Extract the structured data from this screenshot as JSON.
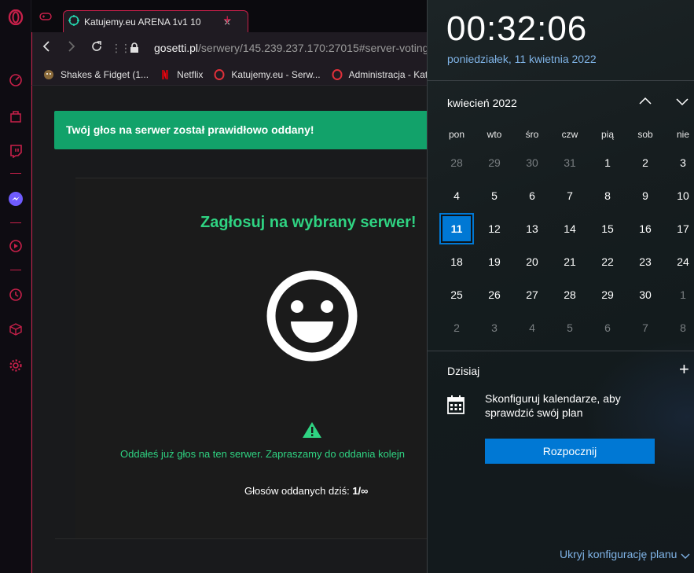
{
  "browser": {
    "tab_title": "Katujemy.eu ARENA 1v1 10",
    "tab_close": "×",
    "new_tab": "+",
    "url_host": "gosetti.pl",
    "url_path": "/serwery/145.239.237.170:27015#server-voting-",
    "bookmarks": [
      {
        "label": "Shakes & Fidget (1...",
        "icon": "shakes-fidget-icon"
      },
      {
        "label": "Netflix",
        "icon": "netflix-icon"
      },
      {
        "label": "Katujemy.eu - Serw...",
        "icon": "opera-small-icon"
      },
      {
        "label": "Administracja - Kat",
        "icon": "opera-small-icon"
      }
    ]
  },
  "page": {
    "alert_text": "Twój głos na serwer został prawidłowo oddany!",
    "vote_title": "Zagłosuj na wybrany serwer!",
    "already_voted": "Oddałeś już głos na ten serwer. Zapraszamy do oddania kolejn",
    "votes_today_label": "Głosów oddanych dziś:",
    "votes_today_value": "1/∞"
  },
  "flyout": {
    "time": "00:32:06",
    "date_long": "poniedziałek, 11 kwietnia 2022",
    "month_label": "kwiecień 2022",
    "weekdays": [
      "pon",
      "wto",
      "śro",
      "czw",
      "pią",
      "sob",
      "nie"
    ],
    "weeks": [
      [
        "28",
        "29",
        "30",
        "31",
        "1",
        "2",
        "3"
      ],
      [
        "4",
        "5",
        "6",
        "7",
        "8",
        "9",
        "10"
      ],
      [
        "11",
        "12",
        "13",
        "14",
        "15",
        "16",
        "17"
      ],
      [
        "18",
        "19",
        "20",
        "21",
        "22",
        "23",
        "24"
      ],
      [
        "25",
        "26",
        "27",
        "28",
        "29",
        "30",
        "1"
      ],
      [
        "2",
        "3",
        "4",
        "5",
        "6",
        "7",
        "8"
      ]
    ],
    "today_label": "Dzisiaj",
    "add_event": "+",
    "configure_text": "Skonfiguruj kalendarze, aby sprawdzić swój plan",
    "start_button": "Rozpocznij",
    "hide_plan": "Ukryj konfigurację planu"
  },
  "colors": {
    "opera_red": "#c8204a",
    "alert_green": "#12a26a",
    "title_green": "#2fd382",
    "windows_blue": "#0078d4",
    "link_blue": "#7fb3e6"
  }
}
